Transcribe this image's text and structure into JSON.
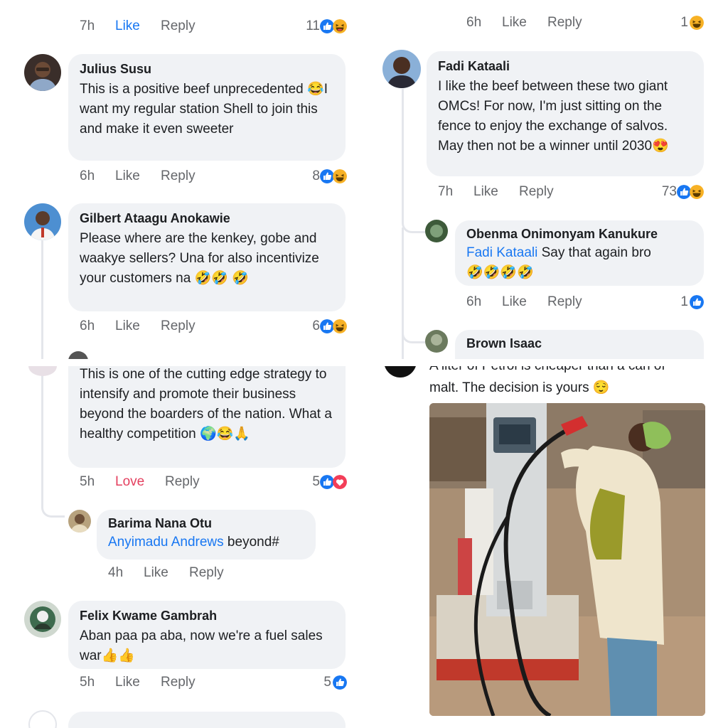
{
  "colors": {
    "bubble": "#f0f2f5",
    "meta_text": "#65676b",
    "link_blue": "#1877f2",
    "love_red": "#e4405f"
  },
  "panel1": {
    "top_row": {
      "time": "7h",
      "like": "Like",
      "reply": "Reply",
      "count": "11",
      "reactions": [
        "like-icon",
        "haha-icon"
      ]
    },
    "c1": {
      "name": "Julius Susu",
      "text": "This is a positive beef unprecedented 😂I want my regular station Shell to join this and make it even sweeter",
      "time": "6h",
      "like": "Like",
      "reply": "Reply",
      "count": "8",
      "reactions": [
        "like-icon",
        "haha-icon"
      ]
    },
    "c2": {
      "name": "Gilbert Ataagu Anokawie",
      "text": "Please where are the kenkey, gobe and waakye sellers? Una for also incentivize your customers na 🤣🤣 🤣",
      "time": "6h",
      "like": "Like",
      "reply": "Reply",
      "count": "6",
      "reactions": [
        "like-icon",
        "haha-icon"
      ]
    }
  },
  "panel2": {
    "top_row": {
      "time": "6h",
      "like": "Like",
      "reply": "Reply",
      "count": "1",
      "reactions": [
        "haha-icon"
      ]
    },
    "c1": {
      "name": "Fadi Kataali",
      "text": "I like the beef between these two giant OMCs! For now, I'm just sitting on the fence to enjoy the exchange of salvos. May then not be a winner until 2030😍",
      "time": "7h",
      "like": "Like",
      "reply": "Reply",
      "count": "73",
      "reactions": [
        "like-icon",
        "haha-icon"
      ]
    },
    "r1": {
      "name": "Obenma Onimonyam Kanukure",
      "tag": "Fadi Kataali",
      "text": " Say that again bro",
      "emoji": "🤣🤣🤣🤣",
      "time": "6h",
      "like": "Like",
      "reply": "Reply",
      "count": "1",
      "reactions": [
        "like-icon"
      ]
    },
    "r2": {
      "name": "Brown Isaac"
    }
  },
  "panel3": {
    "c1": {
      "text": "This is one of the cutting edge strategy to intensify and promote their business beyond the boarders of the nation. What a healthy competition 🌍😂🙏",
      "time": "5h",
      "like": "Love",
      "reply": "Reply",
      "count": "5",
      "reactions": [
        "like-icon",
        "love-icon"
      ]
    },
    "r1": {
      "name": "Barima Nana Otu",
      "tag": "Anyimadu Andrews",
      "text": " beyond#",
      "time": "4h",
      "like": "Like",
      "reply": "Reply"
    },
    "c2": {
      "name": "Felix Kwame Gambrah",
      "text": "Aban paa pa aba, now we're a fuel sales war👍👍",
      "time": "5h",
      "like": "Like",
      "reply": "Reply",
      "count": "5",
      "reactions": [
        "like-icon"
      ]
    }
  },
  "panel4": {
    "post_text_partial": "A liter of Petrol is cheaper than a can of",
    "post_text": "malt. The decision is yours 😌",
    "photo": "woman-drinking-from-fuel-pump-photo"
  }
}
